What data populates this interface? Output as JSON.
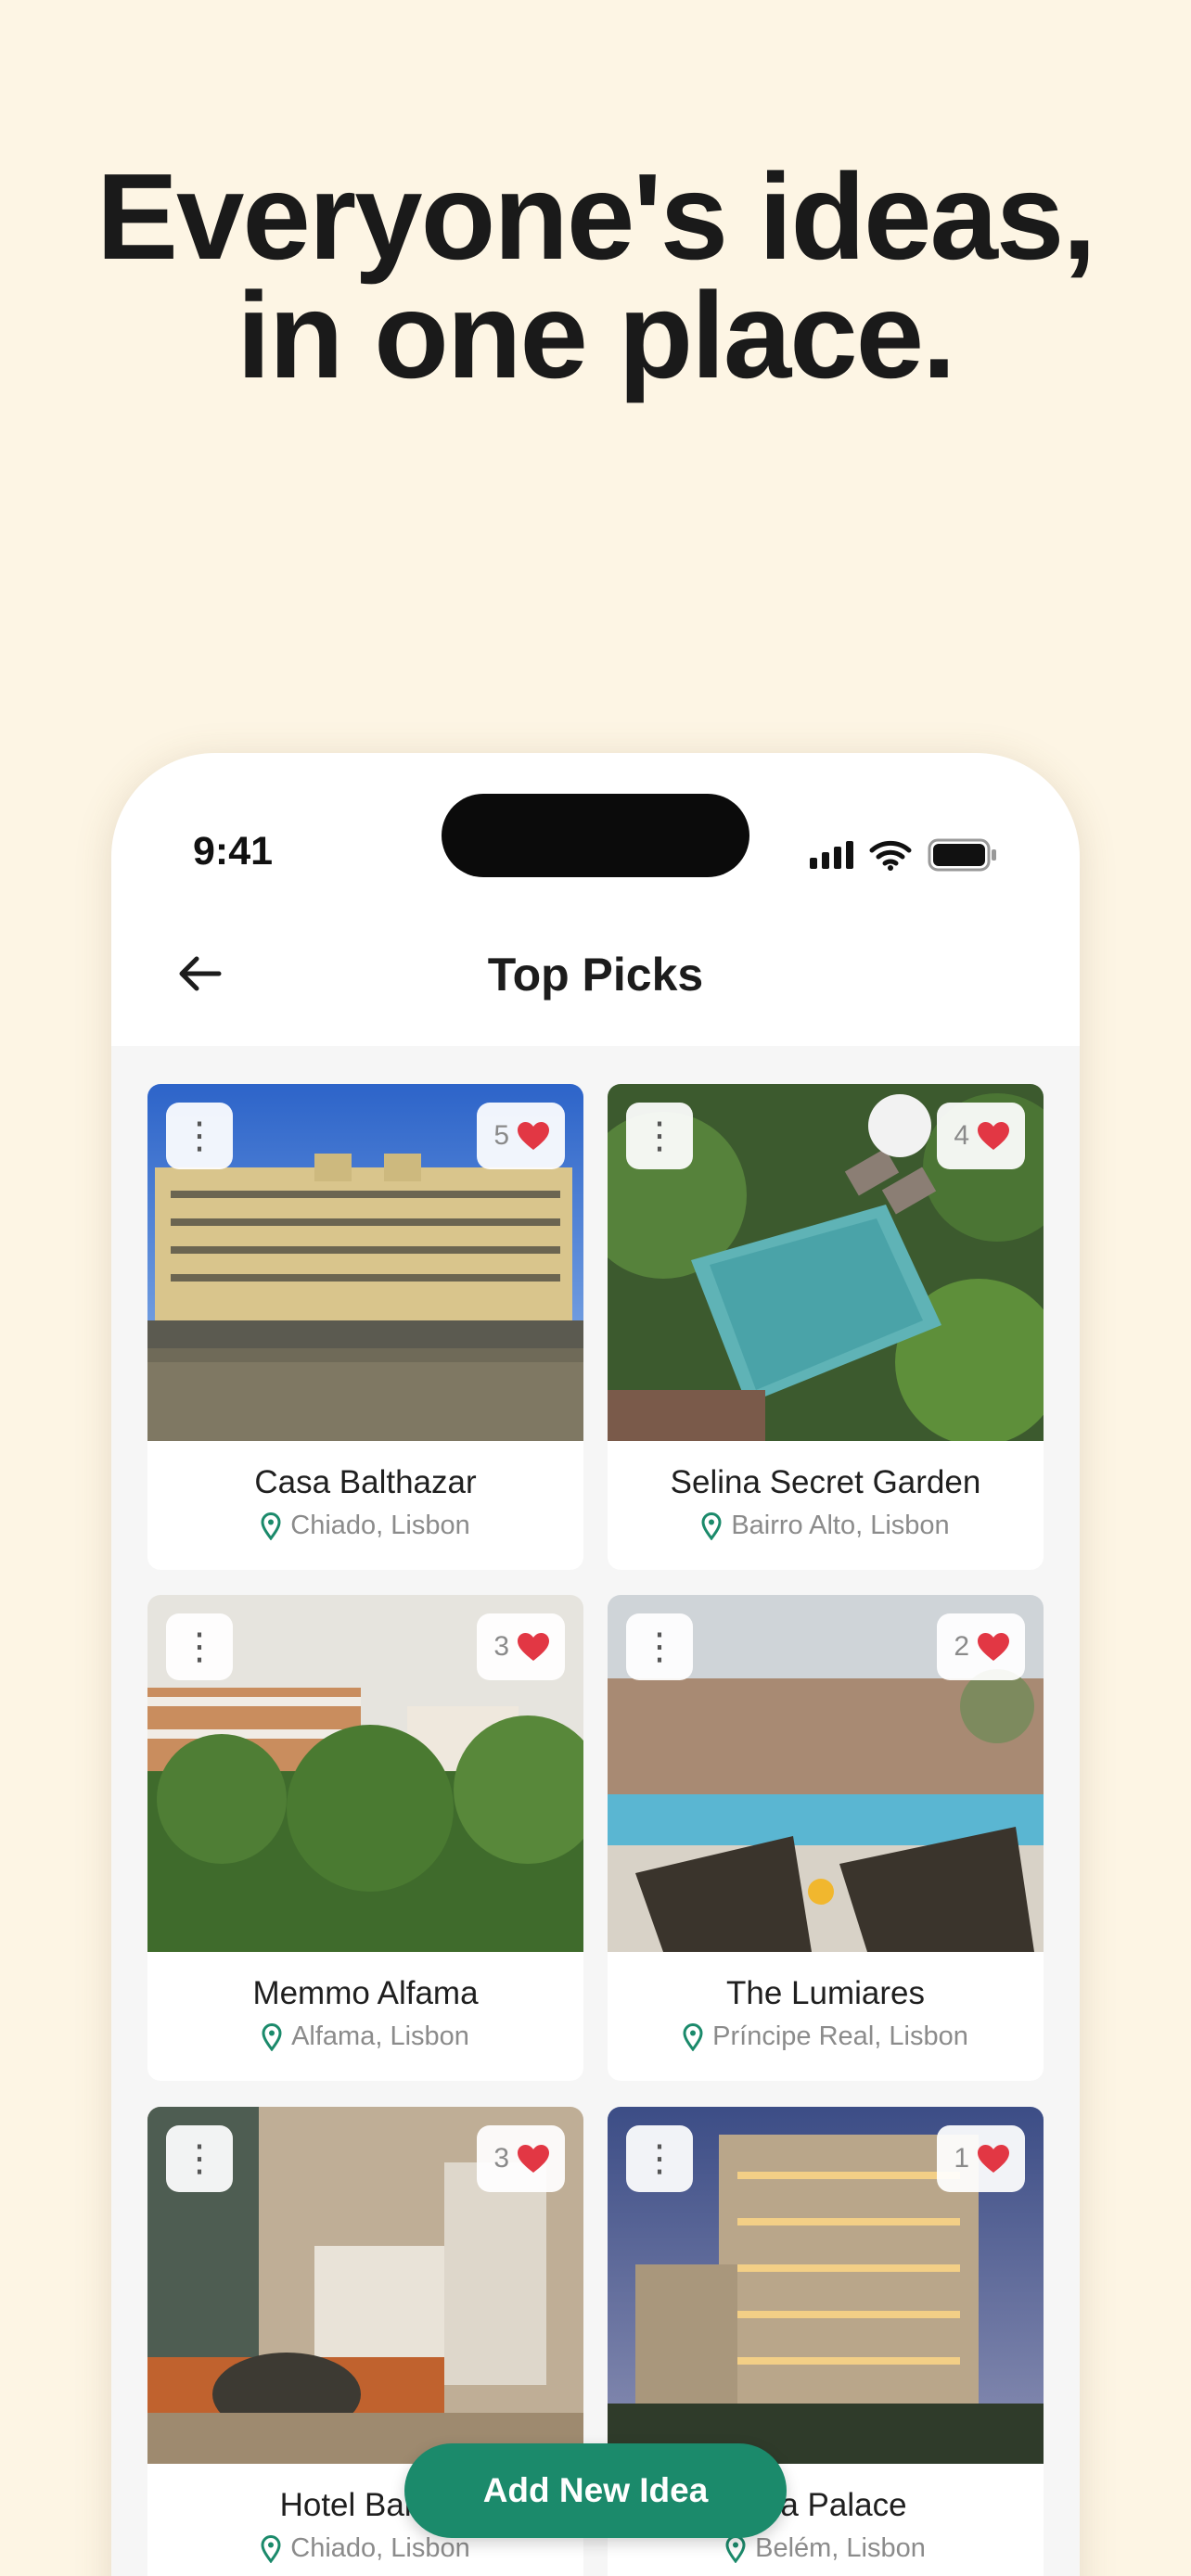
{
  "headline": {
    "line1": "Everyone's ideas,",
    "line2": "in one place."
  },
  "status_bar": {
    "time": "9:41"
  },
  "nav": {
    "title": "Top Picks"
  },
  "menu_glyph": "⋮",
  "cards": [
    {
      "name": "Casa Balthazar",
      "location": "Chiado, Lisbon",
      "likes": "5"
    },
    {
      "name": "Selina Secret Garden",
      "location": "Bairro Alto, Lisbon",
      "likes": "4"
    },
    {
      "name": "Memmo Alfama",
      "location": "Alfama, Lisbon",
      "likes": "3"
    },
    {
      "name": "The Lumiares",
      "location": "Príncipe Real, Lisbon",
      "likes": "2"
    },
    {
      "name": "Hotel Bairro",
      "location": "Chiado, Lisbon",
      "likes": "3"
    },
    {
      "name": "ana Palace",
      "location": "Belém, Lisbon",
      "likes": "1"
    }
  ],
  "add_button": {
    "label": "Add New Idea"
  },
  "colors": {
    "background": "#FDF5E4",
    "accent": "#1B8A6B",
    "heart": "#E23744"
  }
}
